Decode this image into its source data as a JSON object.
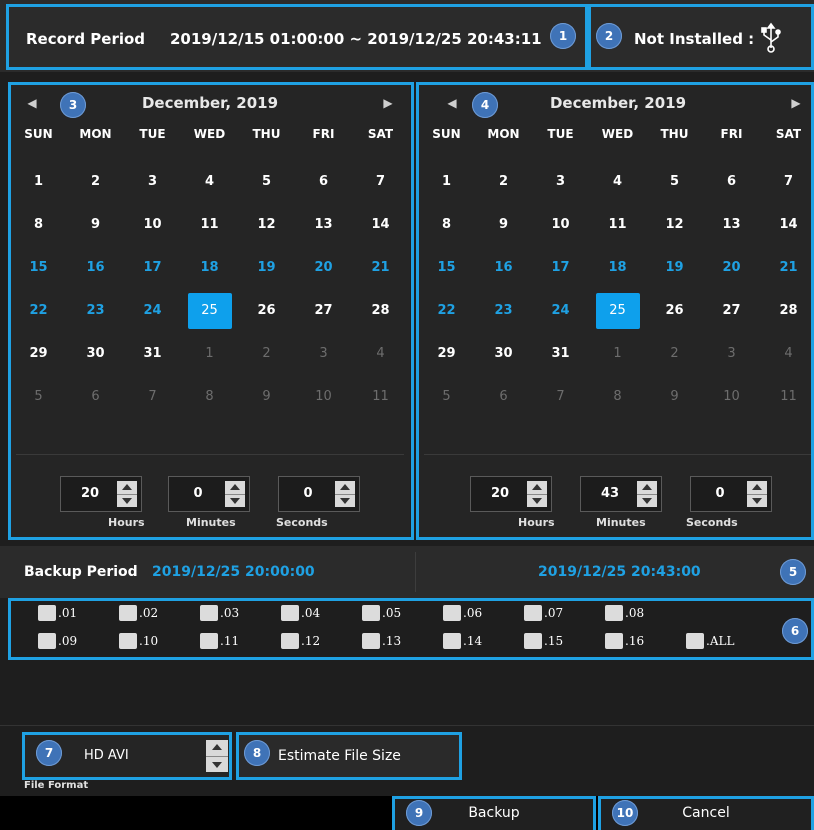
{
  "header": {
    "record_period_label": "Record Period",
    "record_period_value": "2019/12/15 01:00:00 ~ 2019/12/25 20:43:11",
    "usb_status": "Not Installed :",
    "usb_icon": "usb-icon"
  },
  "calendar": {
    "dow": [
      "SUN",
      "MON",
      "TUE",
      "WED",
      "THU",
      "FRI",
      "SAT"
    ],
    "prev": "◀",
    "next": "▶",
    "left": {
      "month": "December, 2019",
      "rows": [
        [
          "1",
          "2",
          "3",
          "4",
          "5",
          "6",
          "7"
        ],
        [
          "8",
          "9",
          "10",
          "11",
          "12",
          "13",
          "14"
        ],
        [
          "15",
          "16",
          "17",
          "18",
          "19",
          "20",
          "21"
        ],
        [
          "22",
          "23",
          "24",
          "25",
          "26",
          "27",
          "28"
        ],
        [
          "29",
          "30",
          "31",
          "1",
          "2",
          "3",
          "4"
        ],
        [
          "5",
          "6",
          "7",
          "8",
          "9",
          "10",
          "11"
        ]
      ],
      "hours": "20",
      "minutes": "0",
      "seconds": "0"
    },
    "right": {
      "month": "December, 2019",
      "rows": [
        [
          "1",
          "2",
          "3",
          "4",
          "5",
          "6",
          "7"
        ],
        [
          "8",
          "9",
          "10",
          "11",
          "12",
          "13",
          "14"
        ],
        [
          "15",
          "16",
          "17",
          "18",
          "19",
          "20",
          "21"
        ],
        [
          "22",
          "23",
          "24",
          "25",
          "26",
          "27",
          "28"
        ],
        [
          "29",
          "30",
          "31",
          "1",
          "2",
          "3",
          "4"
        ],
        [
          "5",
          "6",
          "7",
          "8",
          "9",
          "10",
          "11"
        ]
      ],
      "hours": "20",
      "minutes": "43",
      "seconds": "0"
    },
    "hours_label": "Hours",
    "minutes_label": "Minutes",
    "seconds_label": "Seconds"
  },
  "backup": {
    "label": "Backup Period",
    "start": "2019/12/25 20:00:00",
    "end": "2019/12/25 20:43:00"
  },
  "channels": [
    ".01",
    ".02",
    ".03",
    ".04",
    ".05",
    ".06",
    ".07",
    ".08",
    ".09",
    ".10",
    ".11",
    ".12",
    ".13",
    ".14",
    ".15",
    ".16",
    ".ALL"
  ],
  "format": {
    "value": "HD AVI",
    "caption": "File Format"
  },
  "estimate_label": "Estimate File Size",
  "buttons": {
    "backup": "Backup",
    "cancel": "Cancel"
  },
  "badges": [
    "1",
    "2",
    "3",
    "4",
    "5",
    "6",
    "7",
    "8",
    "9",
    "10"
  ],
  "colors": {
    "accent": "#1fa1e3",
    "selected_day": "#0ea0ec",
    "badge": "#3f73b7"
  }
}
